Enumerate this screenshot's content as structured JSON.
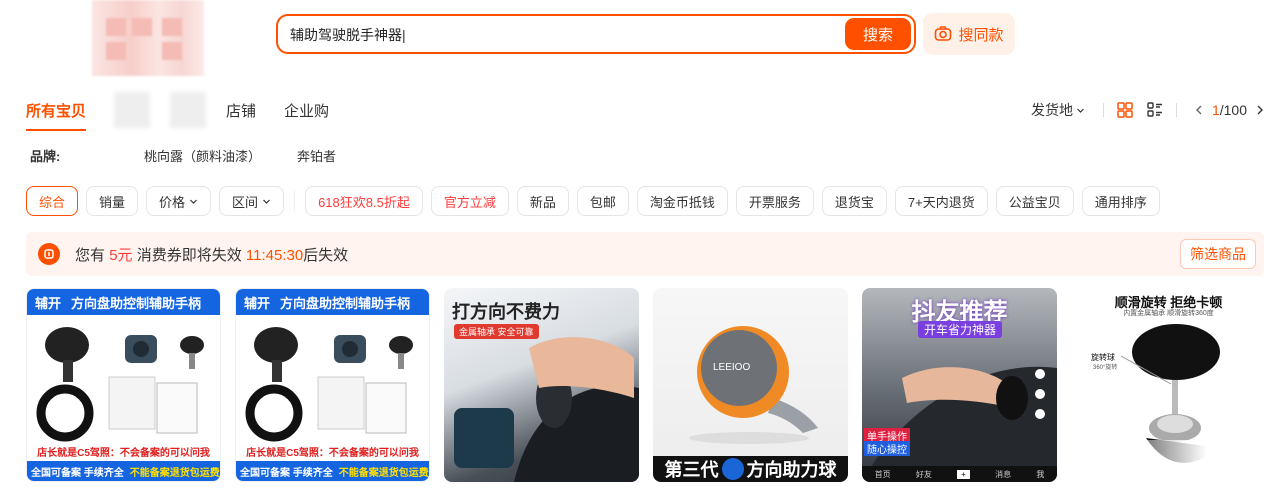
{
  "search": {
    "query": "辅助驾驶脱手神器",
    "button_label": "搜索",
    "same_style_label": "搜同款"
  },
  "tabs": [
    "所有宝贝",
    "店铺",
    "企业购"
  ],
  "toolbar": {
    "location_label": "发货地",
    "page_current": "1",
    "page_total": "/100"
  },
  "brands": {
    "label": "品牌:",
    "items": [
      "桃向露（颜料油漆）",
      "奔铂者"
    ]
  },
  "filters": {
    "sort": [
      "综合",
      "销量"
    ],
    "dropdowns": [
      "价格",
      "区间"
    ],
    "chips": [
      "618狂欢8.5折起",
      "官方立减",
      "新品",
      "包邮",
      "淘金币抵钱",
      "开票服务",
      "退货宝",
      "7+天内退货",
      "公益宝贝",
      "通用排序"
    ]
  },
  "coupon": {
    "prefix": "您有",
    "amount": "5元",
    "middle": "消费券即将失效",
    "countdown": "11:45:30",
    "suffix": "后失效",
    "button_label": "筛选商品"
  },
  "products": [
    {
      "banner_brand": "辅开",
      "banner_title": "方向盘助控制辅助手柄",
      "tag_red": "店长就是C5驾照：不会备案的可以问我",
      "foot_white": "全国可备案 手续齐全",
      "foot_yellow": "不能备案退货包运费"
    },
    {
      "banner_brand": "辅开",
      "banner_title": "方向盘助控制辅助手柄",
      "tag_red": "店长就是C5驾照：不会备案的可以问我",
      "foot_white": "全国可备案 手续齐全",
      "foot_yellow": "不能备案退货包运费"
    },
    {
      "title": "打方向不费力",
      "subtitle": "金属轴承 安全可靠"
    },
    {
      "logo": "LEEIOO",
      "foot_left": "第三代",
      "foot_right": "方向助力球"
    },
    {
      "title": "抖友推荐",
      "subtitle": "开车省力神器",
      "tag1": "单手操作",
      "tag2": "随心操控",
      "bar": [
        "首页",
        "好友",
        "+",
        "消息",
        "我"
      ]
    },
    {
      "title": "顺滑旋转 拒绝卡顿",
      "subtitle": "内置金属轴承 顺滑旋转360度",
      "label1": "旋转球",
      "label2": "360°旋转"
    }
  ],
  "colors": {
    "accent": "#ff5000",
    "blue_banner": "#1565e0",
    "warn_red": "#ff3c3c"
  }
}
